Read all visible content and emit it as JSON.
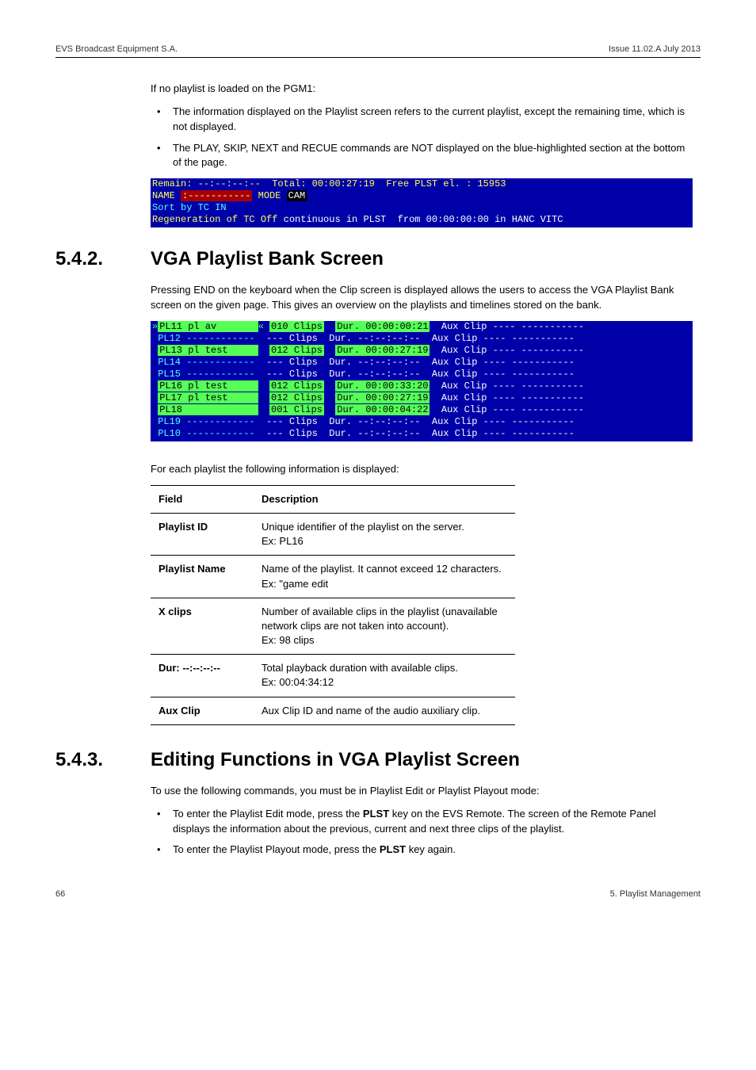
{
  "header": {
    "left": "EVS Broadcast Equipment S.A.",
    "right": "Issue 11.02.A  July 2013"
  },
  "intro": {
    "lead": "If no playlist is loaded on the PGM1:",
    "bullets": [
      "The information displayed on the Playlist screen refers to the current playlist, except the remaining time, which is not displayed.",
      "The PLAY, SKIP, NEXT and RECUE commands are NOT displayed on the blue-highlighted section at the bottom of the page."
    ]
  },
  "panel1": {
    "line1a": "Remain: --:--:--:--  Total: 00:00:27:19  Free PLST el. : 15953",
    "line2_name": "NAME ",
    "line2_blank": ":-----------",
    "line2_mode": " MODE ",
    "line2_cam": "CAM",
    "line3": "Sort by TC IN",
    "line4a": "Regeneration of TC Off ",
    "line4b": "continuous in PLST  from 00:00:00:00 in HANC VITC"
  },
  "sec542": {
    "num": "5.4.2.",
    "title": "VGA Playlist Bank Screen",
    "para": "Pressing END on the keyboard when the Clip screen is displayed allows the users to access the VGA Playlist Bank screen on the given page. This gives an overview on the playlists and timelines stored on the bank."
  },
  "panel2": {
    "rows": [
      {
        "id": "PL11",
        "name": "pl av       ",
        "clips": "010 Clips",
        "dur": "Dur. 00:00:00:21",
        "aux": "Aux Clip ---- -----------",
        "sel": true,
        "hasInfo": true
      },
      {
        "id": "PL12",
        "name": "------------",
        "clips": "--- Clips",
        "dur": "Dur. --:--:--:--",
        "aux": "Aux Clip ---- -----------",
        "sel": false,
        "hasInfo": false
      },
      {
        "id": "PL13",
        "name": "pl test     ",
        "clips": "012 Clips",
        "dur": "Dur. 00:00:27:19",
        "aux": "Aux Clip ---- -----------",
        "sel": false,
        "hasInfo": true
      },
      {
        "id": "PL14",
        "name": "------------",
        "clips": "--- Clips",
        "dur": "Dur. --:--:--:--",
        "aux": "Aux Clip ---- -----------",
        "sel": false,
        "hasInfo": false
      },
      {
        "id": "PL15",
        "name": "------------",
        "clips": "--- Clips",
        "dur": "Dur. --:--:--:--",
        "aux": "Aux Clip ---- -----------",
        "sel": false,
        "hasInfo": false
      },
      {
        "id": "PL16",
        "name": "pl test     ",
        "clips": "012 Clips",
        "dur": "Dur. 00:00:33:20",
        "aux": "Aux Clip ---- -----------",
        "sel": false,
        "hasInfo": true
      },
      {
        "id": "PL17",
        "name": "pl test     ",
        "clips": "012 Clips",
        "dur": "Dur. 00:00:27:19",
        "aux": "Aux Clip ---- -----------",
        "sel": false,
        "hasInfo": true
      },
      {
        "id": "PL18",
        "name": "            ",
        "clips": "001 Clips",
        "dur": "Dur. 00:00:04:22",
        "aux": "Aux Clip ---- -----------",
        "sel": false,
        "hasInfo": true
      },
      {
        "id": "PL19",
        "name": "------------",
        "clips": "--- Clips",
        "dur": "Dur. --:--:--:--",
        "aux": "Aux Clip ---- -----------",
        "sel": false,
        "hasInfo": false
      },
      {
        "id": "PL10",
        "name": "------------",
        "clips": "--- Clips",
        "dur": "Dur. --:--:--:--",
        "aux": "Aux Clip ---- -----------",
        "sel": false,
        "hasInfo": false
      }
    ],
    "caption": "For each playlist the following information is displayed:"
  },
  "fields_table": {
    "headers": [
      "Field",
      "Description"
    ],
    "rows": [
      [
        "Playlist ID",
        "Unique identifier of the playlist on the server.\nEx: PL16"
      ],
      [
        "Playlist Name",
        "Name of the playlist. It cannot exceed 12 characters.\nEx: \"game edit"
      ],
      [
        "X clips",
        "Number of available clips in the playlist (unavailable network clips are not taken into account).\nEx: 98 clips"
      ],
      [
        "Dur: --:--:--:--",
        "Total playback duration with available clips.\nEx: 00:04:34:12"
      ],
      [
        "Aux Clip",
        "Aux Clip ID and name of the audio auxiliary clip."
      ]
    ]
  },
  "sec543": {
    "num": "5.4.3.",
    "title": "Editing Functions in VGA Playlist Screen",
    "para": "To use the following commands, you must be in Playlist Edit or Playlist Playout mode:",
    "bullets": [
      {
        "pre": "To enter the Playlist Edit mode, press the ",
        "bold": "PLST",
        "post": " key on the EVS Remote. The screen of the Remote Panel displays the information about the previous, current and next three clips of the playlist."
      },
      {
        "pre": "To enter the Playlist Playout mode, press the ",
        "bold": "PLST",
        "post": " key again."
      }
    ]
  },
  "footer": {
    "left": "66",
    "right": "5. Playlist Management"
  }
}
